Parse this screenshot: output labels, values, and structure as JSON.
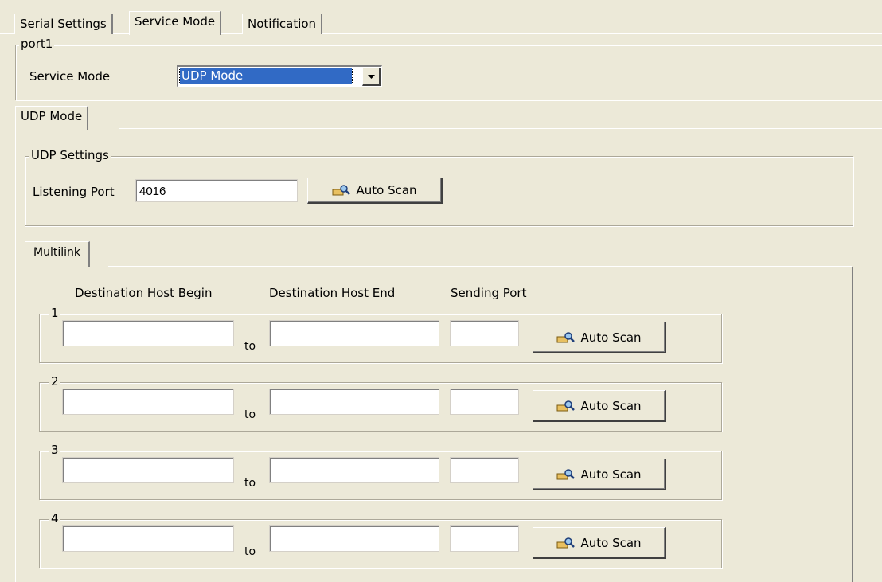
{
  "tabs": [
    "Serial Settings",
    "Service Mode",
    "Notification"
  ],
  "port_group": {
    "legend": "port1",
    "service_mode_label": "Service Mode",
    "service_mode_value": "UDP Mode"
  },
  "subtab": "UDP Mode",
  "udp_settings": {
    "legend": "UDP Settings",
    "listening_port_label": "Listening Port",
    "listening_port_value": "4016",
    "auto_scan_label": "Auto Scan"
  },
  "multilink": {
    "tab": "Multilink",
    "col_begin": "Destination Host Begin",
    "col_end": "Destination Host End",
    "col_port": "Sending Port",
    "to_label": "to",
    "auto_scan_label": "Auto Scan",
    "rows": [
      {
        "index": "1",
        "begin": "",
        "end": "",
        "port": ""
      },
      {
        "index": "2",
        "begin": "",
        "end": "",
        "port": ""
      },
      {
        "index": "3",
        "begin": "",
        "end": "",
        "port": ""
      },
      {
        "index": "4",
        "begin": "",
        "end": "",
        "port": ""
      }
    ]
  },
  "icons": {
    "scan": "scan-magnifier-icon",
    "dropdown": "chevron-down-icon"
  },
  "colors": {
    "face": "#ece9d8",
    "selection": "#316ac5"
  }
}
